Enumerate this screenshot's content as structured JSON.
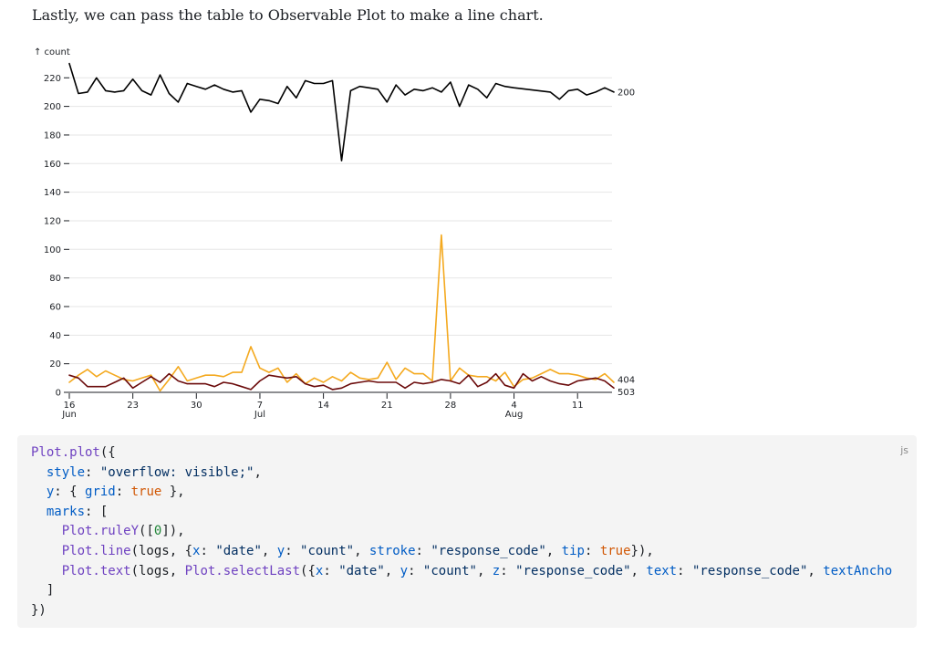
{
  "intro": "Lastly, we can pass the table to Observable Plot to make a line chart.",
  "chart_data": {
    "type": "line",
    "ylabel": "↑ count",
    "xlabel": "",
    "ylim": [
      0,
      230
    ],
    "yticks": [
      0,
      20,
      40,
      60,
      80,
      100,
      120,
      140,
      160,
      180,
      200,
      220
    ],
    "grid": true,
    "x_start": "2023-06-16",
    "x": [
      "06-16",
      "06-17",
      "06-18",
      "06-19",
      "06-20",
      "06-21",
      "06-22",
      "06-23",
      "06-24",
      "06-25",
      "06-26",
      "06-27",
      "06-28",
      "06-29",
      "06-30",
      "07-01",
      "07-02",
      "07-03",
      "07-04",
      "07-05",
      "07-06",
      "07-07",
      "07-08",
      "07-09",
      "07-10",
      "07-11",
      "07-12",
      "07-13",
      "07-14",
      "07-15",
      "07-16",
      "07-17",
      "07-18",
      "07-19",
      "07-20",
      "07-21",
      "07-22",
      "07-23",
      "07-24",
      "07-25",
      "07-26",
      "07-27",
      "07-28",
      "07-29",
      "07-30",
      "07-31",
      "08-01",
      "08-02",
      "08-03",
      "08-04",
      "08-08",
      "08-09",
      "08-10",
      "08-11",
      "08-12",
      "08-13",
      "08-14",
      "08-15"
    ],
    "xticks": [
      {
        "day": 0,
        "label": "16",
        "sub": "Jun"
      },
      {
        "day": 7,
        "label": "23",
        "sub": ""
      },
      {
        "day": 14,
        "label": "30",
        "sub": ""
      },
      {
        "day": 21,
        "label": "7",
        "sub": "Jul"
      },
      {
        "day": 28,
        "label": "14",
        "sub": ""
      },
      {
        "day": 35,
        "label": "21",
        "sub": ""
      },
      {
        "day": 42,
        "label": "28",
        "sub": ""
      },
      {
        "day": 49,
        "label": "4",
        "sub": "Aug"
      },
      {
        "day": 56,
        "label": "11",
        "sub": ""
      }
    ],
    "series": [
      {
        "name": "200",
        "color": "#000000",
        "days": [
          0,
          1,
          2,
          3,
          4,
          5,
          6,
          7,
          8,
          9,
          10,
          11,
          12,
          13,
          14,
          15,
          16,
          17,
          18,
          19,
          20,
          21,
          22,
          23,
          24,
          25,
          26,
          27,
          28,
          29,
          30,
          31,
          32,
          33,
          34,
          35,
          36,
          37,
          38,
          39,
          40,
          41,
          42,
          43,
          44,
          45,
          46,
          47,
          48,
          49,
          53,
          54,
          55,
          56,
          57,
          58,
          59,
          60
        ],
        "values": [
          230,
          209,
          210,
          220,
          211,
          210,
          211,
          219,
          211,
          208,
          222,
          209,
          203,
          216,
          214,
          212,
          215,
          212,
          210,
          211,
          196,
          205,
          204,
          202,
          214,
          206,
          218,
          216,
          216,
          218,
          162,
          211,
          214,
          213,
          212,
          203,
          215,
          208,
          212,
          211,
          213,
          210,
          217,
          200,
          215,
          212,
          206,
          216,
          214,
          213,
          210,
          205,
          211,
          212,
          208,
          210,
          213,
          210,
          194
        ],
        "end_label": "200"
      },
      {
        "name": "404",
        "color": "#f4a91f",
        "days": [
          0,
          1,
          2,
          3,
          4,
          5,
          6,
          7,
          8,
          9,
          10,
          11,
          12,
          13,
          14,
          15,
          16,
          17,
          18,
          19,
          20,
          21,
          22,
          23,
          24,
          25,
          26,
          27,
          28,
          29,
          30,
          31,
          32,
          33,
          34,
          35,
          36,
          37,
          38,
          39,
          40,
          41,
          42,
          43,
          44,
          45,
          46,
          47,
          48,
          49,
          50,
          51,
          52,
          53,
          54,
          55,
          56,
          57,
          58,
          59,
          60
        ],
        "values": [
          7,
          12,
          16,
          11,
          15,
          12,
          9,
          8,
          10,
          12,
          1,
          9,
          18,
          8,
          10,
          12,
          12,
          11,
          14,
          14,
          32,
          17,
          14,
          17,
          7,
          13,
          6,
          10,
          7,
          11,
          8,
          14,
          10,
          9,
          10,
          21,
          9,
          17,
          13,
          13,
          8,
          110,
          8,
          17,
          12,
          11,
          11,
          8,
          14,
          4,
          9,
          10,
          13,
          16,
          13,
          13,
          12,
          10,
          9,
          13,
          7
        ],
        "end_label": "404"
      },
      {
        "name": "503",
        "color": "#6b0b0b",
        "days": [
          0,
          1,
          2,
          3,
          4,
          5,
          6,
          7,
          8,
          9,
          10,
          11,
          12,
          13,
          14,
          15,
          16,
          17,
          18,
          19,
          20,
          21,
          22,
          23,
          24,
          25,
          26,
          27,
          28,
          29,
          30,
          31,
          32,
          33,
          34,
          35,
          36,
          37,
          38,
          39,
          40,
          41,
          42,
          43,
          44,
          45,
          46,
          47,
          48,
          49,
          50,
          51,
          52,
          53,
          54,
          55,
          56,
          57,
          58,
          59,
          60
        ],
        "values": [
          12,
          10,
          4,
          4,
          4,
          7,
          10,
          3,
          7,
          11,
          7,
          13,
          8,
          6,
          6,
          6,
          4,
          7,
          6,
          4,
          2,
          8,
          12,
          11,
          10,
          11,
          6,
          4,
          5,
          2,
          3,
          6,
          7,
          8,
          7,
          7,
          7,
          3,
          7,
          6,
          7,
          9,
          8,
          6,
          12,
          4,
          7,
          13,
          5,
          3,
          13,
          8,
          11,
          8,
          6,
          5,
          8,
          9,
          10,
          8,
          3
        ],
        "end_label": "503"
      }
    ]
  },
  "code": {
    "lang": "js",
    "line1": {
      "fn": "Plot.plot",
      "rest": "({"
    },
    "line2": {
      "key": "style",
      "colon": ": ",
      "str": "\"overflow: visible;\"",
      "end": ","
    },
    "line3": {
      "key": "y",
      "mid": ": { ",
      "key2": "grid",
      "colon": ": ",
      "bool": "true",
      "end": " },"
    },
    "line4": {
      "key": "marks",
      "end": ": ["
    },
    "line5": {
      "fn": "Plot.ruleY",
      "open": "([",
      "num": "0",
      "close": "]),"
    },
    "line6": {
      "fn": "Plot.line",
      "a": "(logs, {",
      "k1": "x",
      "c1": ": ",
      "s1": "\"date\"",
      "sep1": ", ",
      "k2": "y",
      "c2": ": ",
      "s2": "\"count\"",
      "sep2": ", ",
      "k3": "stroke",
      "c3": ": ",
      "s3": "\"response_code\"",
      "sep3": ", ",
      "k4": "tip",
      "c4": ": ",
      "b4": "true",
      "end": "}),"
    },
    "line7": {
      "fn": "Plot.text",
      "a": "(logs, ",
      "fn2": "Plot.selectLast",
      "b": "({",
      "k1": "x",
      "c1": ": ",
      "s1": "\"date\"",
      "sep1": ", ",
      "k2": "y",
      "c2": ": ",
      "s2": "\"count\"",
      "sep2": ", ",
      "k3": "z",
      "c3": ": ",
      "s3": "\"response_code\"",
      "sep3": ", ",
      "k4": "text",
      "c4": ": ",
      "s4": "\"response_code\"",
      "sep4": ", ",
      "k5": "textAncho"
    },
    "line8": "]",
    "line9": "})"
  }
}
